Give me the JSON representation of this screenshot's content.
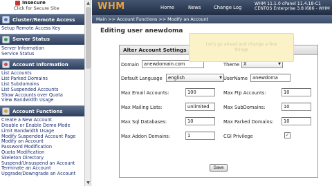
{
  "sidebar": {
    "insecure": "Insecure",
    "secure_link": "Click for Secure Site",
    "sections": [
      {
        "title": "Cluster/Remote Access",
        "items": [
          "Setup Remote Access Key"
        ]
      },
      {
        "title": "Server Status",
        "items": [
          "Server Information",
          "Service Status"
        ]
      },
      {
        "title": "Account Information",
        "items": [
          "List Accounts",
          "List Parked Domains",
          "List Subdomains",
          "List Suspended Accounts",
          "Show Accounts over Quota",
          "View Bandwidth Usage"
        ]
      },
      {
        "title": "Account Functions",
        "items": [
          "Create a New Account",
          "Disable or Enable Demo Mode",
          "Limit Bandwidth Usage",
          "Modify Suspended Account Page",
          "Modify an Account",
          "Password Modification",
          "Quota Modification",
          "Skeleton Directory",
          "Suspend/Unsuspend an Account",
          "Terminate an Account",
          "Upgrade/Downgrade an Account"
        ]
      }
    ]
  },
  "header": {
    "logo": "WHM",
    "nav": [
      "Home",
      "News",
      "Change Log"
    ],
    "server_info": [
      "WHM 11.1.0 cPanel 11.4.18-C1",
      "CENTOS Enterprise 3.8 i686 - WHM X v"
    ]
  },
  "breadcrumb": "Main >> Account Functions >> Modify an Account",
  "main": {
    "title": "Editing user anewdoma",
    "tooltip": [
      "Let's go ahead and change a few",
      "things"
    ],
    "panel_title": "Alter Account Settings",
    "fields": {
      "domain_label": "Domain",
      "domain_value": "anewdomain.com",
      "theme_label": "Theme",
      "theme_value": "X",
      "language_label": "Default Language",
      "language_value": "english",
      "username_label": "UserName",
      "username_value": "anewdoma",
      "max_email_label": "Max Email Accounts:",
      "max_email_value": "100",
      "max_ftp_label": "Max Ftp Accounts:",
      "max_ftp_value": "10",
      "max_mailing_label": "Max Mailing Lists:",
      "max_mailing_value": "unlimited",
      "max_sub_label": "Max SubDomains:",
      "max_sub_value": "10",
      "max_sql_label": "Max Sql Databases:",
      "max_sql_value": "10",
      "max_parked_label": "Max Parked Domains:",
      "max_parked_value": "10",
      "max_addon_label": "Max Addon Domains:",
      "max_addon_value": "1",
      "cgi_label": "CGI Privilege",
      "cgi_checked": true
    },
    "save_label": "Save"
  },
  "colors": {
    "header_bg": "#2d3e5c",
    "logo": "#e8a23a",
    "link": "#1c2f73",
    "tooltip_bg": "#fbf2c8"
  }
}
